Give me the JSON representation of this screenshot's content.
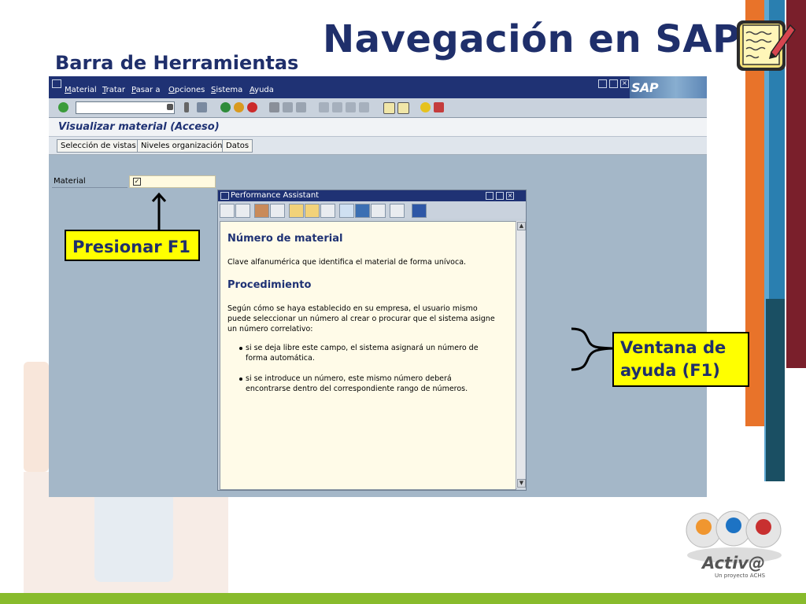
{
  "slide": {
    "title": "Navegación en SAP",
    "subtitle": "Barra de Herramientas",
    "icon": "notepad-pencil-icon"
  },
  "sap": {
    "menu": [
      "Material",
      "Tratar",
      "Pasar a",
      "Opciones",
      "Sistema",
      "Ayuda"
    ],
    "logo": "SAP",
    "screen_title": "Visualizar material (Acceso)",
    "app_buttons": [
      "Selección de vistas",
      "Niveles organización",
      "Datos"
    ],
    "field_label": "Material",
    "field_value": "",
    "toolbar_icons": [
      "enter-icon",
      "save-icon",
      "back-icon",
      "exit-icon",
      "cancel-icon",
      "print-icon",
      "find-icon",
      "find-next-icon",
      "first-page-icon",
      "prev-page-icon",
      "next-page-icon",
      "last-page-icon",
      "new-session-icon",
      "shortcut-icon",
      "help-icon",
      "layout-icon"
    ]
  },
  "assistant": {
    "title": "Performance Assistant",
    "heading1": "Número de material",
    "text1": "Clave alfanumérica que identifica el material de forma unívoca.",
    "heading2": "Procedimiento",
    "text2": "Según cómo se haya establecido en su empresa, el usuario mismo puede seleccionar un número al crear o procurar que el sistema asigne un número correlativo:",
    "bullets": [
      "si se deja libre este campo, el sistema asignará un número de forma automática.",
      "si se introduce un número, este mismo número deberá encontrarse dentro del correspondiente rango de números."
    ]
  },
  "callouts": {
    "press_f1": "Presionar F1",
    "help_window_line1": "Ventana de",
    "help_window_line2": "ayuda (F1)"
  },
  "logo": {
    "name": "Activ@",
    "tagline": "Un proyecto ACHS"
  },
  "colors": {
    "title_blue": "#1f2f6b",
    "sap_blue": "#1f3274",
    "callout_yellow": "#ffff00",
    "stripe_orange": "#e8732a",
    "stripe_blue": "#2a7fb0",
    "stripe_dark_red": "#7a1f2b",
    "stripe_teal": "#1a4f63",
    "bottom_green": "#88bb2c"
  }
}
